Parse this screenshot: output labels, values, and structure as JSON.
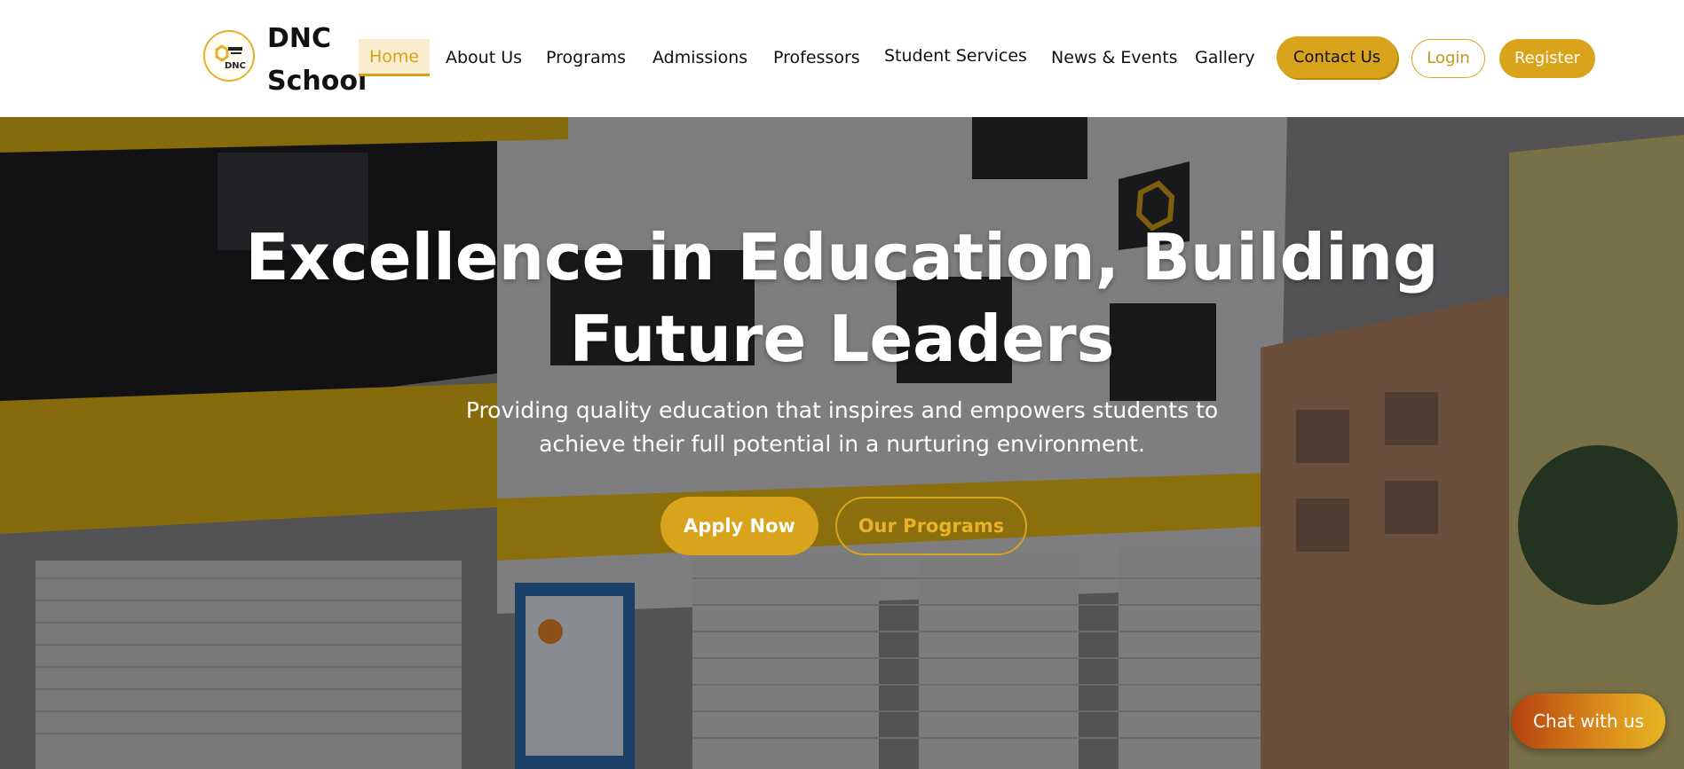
{
  "brand": {
    "name_line1": "DNC",
    "name_line2": "School",
    "logo_icon": "dnc-school-logo"
  },
  "nav": {
    "items": [
      {
        "label": "Home",
        "active": true
      },
      {
        "label": "About Us",
        "active": false
      },
      {
        "label": "Programs",
        "active": false
      },
      {
        "label": "Admissions",
        "active": false
      },
      {
        "label": "Professors",
        "active": false
      },
      {
        "label": "Student Services",
        "active": false
      },
      {
        "label": "News & Events",
        "active": false
      },
      {
        "label": "Gallery",
        "active": false
      }
    ]
  },
  "actions": {
    "contact": "Contact Us",
    "login": "Login",
    "register": "Register"
  },
  "hero": {
    "title": "Excellence in Education, Building Future Leaders",
    "subtitle": "Providing quality education that inspires and empowers students to achieve their full potential in a nurturing environment.",
    "primary_cta": "Apply Now",
    "secondary_cta": "Our Programs"
  },
  "chat": {
    "label": "Chat with us"
  },
  "colors": {
    "accent": "#d9a31b",
    "accent_light": "#fbeed0",
    "building_yellow": "#f2c21a",
    "text": "#111111"
  }
}
